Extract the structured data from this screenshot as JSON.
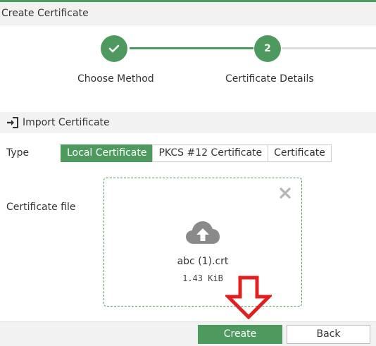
{
  "dialog": {
    "title": "Create Certificate"
  },
  "stepper": {
    "steps": [
      {
        "number": "",
        "label": "Choose Method",
        "state": "done",
        "icon": "checkmark-icon"
      },
      {
        "number": "2",
        "label": "Certificate Details",
        "state": "current"
      }
    ]
  },
  "section": {
    "title": "Import Certificate",
    "icon": "import-icon"
  },
  "type_field": {
    "label": "Type",
    "options": [
      "Local Certificate",
      "PKCS #12 Certificate",
      "Certificate"
    ],
    "selected": "Local Certificate"
  },
  "file_field": {
    "label": "Certificate file",
    "file_name": "abc (1).crt",
    "file_size": "1.43 KiB",
    "upload_icon": "cloud-upload-icon",
    "remove_icon": "close-icon"
  },
  "buttons": {
    "create": "Create",
    "back": "Back"
  },
  "annotation": {
    "icon": "red-down-arrow-icon",
    "color": "#e02020"
  },
  "colors": {
    "accent": "#4e9a5e",
    "header_bg": "#f2f2f2"
  }
}
